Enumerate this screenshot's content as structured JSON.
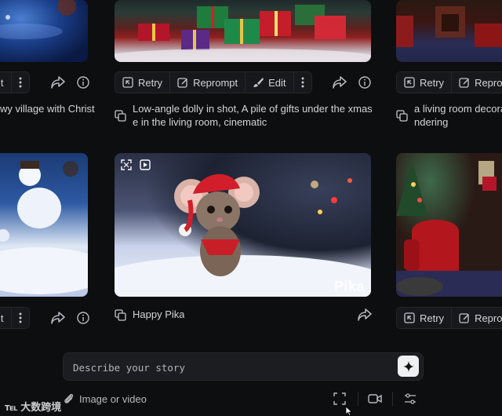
{
  "actions": {
    "retry": "Retry",
    "reprompt": "Reprompt",
    "reprompt_cut": "Repro",
    "edit": "Edit",
    "edit_cut": "it"
  },
  "cards": {
    "top_left_caption": "wy village with Christ",
    "top_center_caption_line1": "Low-angle dolly in shot, A pile of gifts under the xmas tre",
    "top_center_caption_line2": "e in the living room, cinematic",
    "top_right_caption_line1": "a living room decorat",
    "top_right_caption_line2": "ndering",
    "mid_center_caption": "Happy Pika",
    "watermark": "Pika"
  },
  "prompt": {
    "placeholder": "Describe your story"
  },
  "bottom": {
    "image_or_video": "Image or video",
    "logo_text": "大数跨境"
  },
  "colors": {
    "background": "#0d0e10",
    "button_bg": "#17181c",
    "generate_button": "#eef0f3"
  }
}
